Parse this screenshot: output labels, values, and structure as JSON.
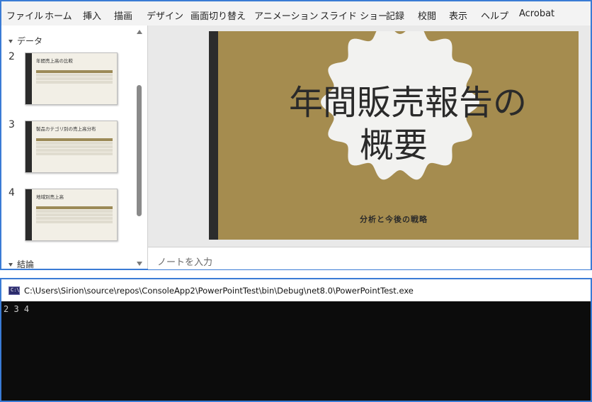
{
  "ribbon": {
    "tabs": [
      "ファイル",
      "ホーム",
      "挿入",
      "描画",
      "デザイン",
      "画面切り替え",
      "アニメーション",
      "スライド ショー",
      "記録",
      "校閲",
      "表示",
      "ヘルプ",
      "Acrobat"
    ]
  },
  "sections": {
    "data": "データ",
    "conclusion": "結論"
  },
  "thumbnails": [
    {
      "number": "2",
      "title": "年間売上高の比較"
    },
    {
      "number": "3",
      "title": "製品カテゴリ別の売上高分布"
    },
    {
      "number": "4",
      "title": "地域別売上高"
    }
  ],
  "slide": {
    "title_line1": "年間販売報告の",
    "title_line2": "概要",
    "subtitle": "分析と今後の戦略",
    "colors": {
      "background": "#a58c4f",
      "accent_bar": "#2c2c2c",
      "badge": "#f2f2f0"
    }
  },
  "notes": {
    "placeholder": "ノートを入力"
  },
  "console": {
    "icon_label": "C:\\",
    "path": "C:\\Users\\Sirion\\source\\repos\\ConsoleApp2\\PowerPointTest\\bin\\Debug\\net8.0\\PowerPointTest.exe",
    "output": "2 3 4"
  }
}
